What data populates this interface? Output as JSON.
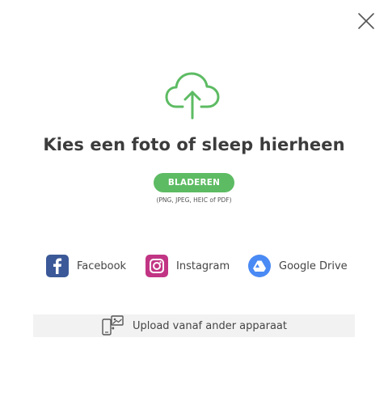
{
  "dialog": {
    "close_icon": "close-icon",
    "upload_icon": "cloud-upload-icon",
    "title": "Kies een foto of sleep hierheen",
    "browse_label": "BLADEREN",
    "formats_hint": "(PNG, JPEG, HEIC of PDF)",
    "accent_color": "#5dbb63"
  },
  "sources": [
    {
      "label": "Facebook",
      "icon": "facebook-icon",
      "color": "#3b5998"
    },
    {
      "label": "Instagram",
      "icon": "instagram-icon",
      "color": "#c13584"
    },
    {
      "label": "Google Drive",
      "icon": "google-drive-icon",
      "color": "#4a8af4"
    }
  ],
  "device_upload": {
    "label": "Upload vanaf ander apparaat",
    "icon": "device-transfer-icon"
  }
}
